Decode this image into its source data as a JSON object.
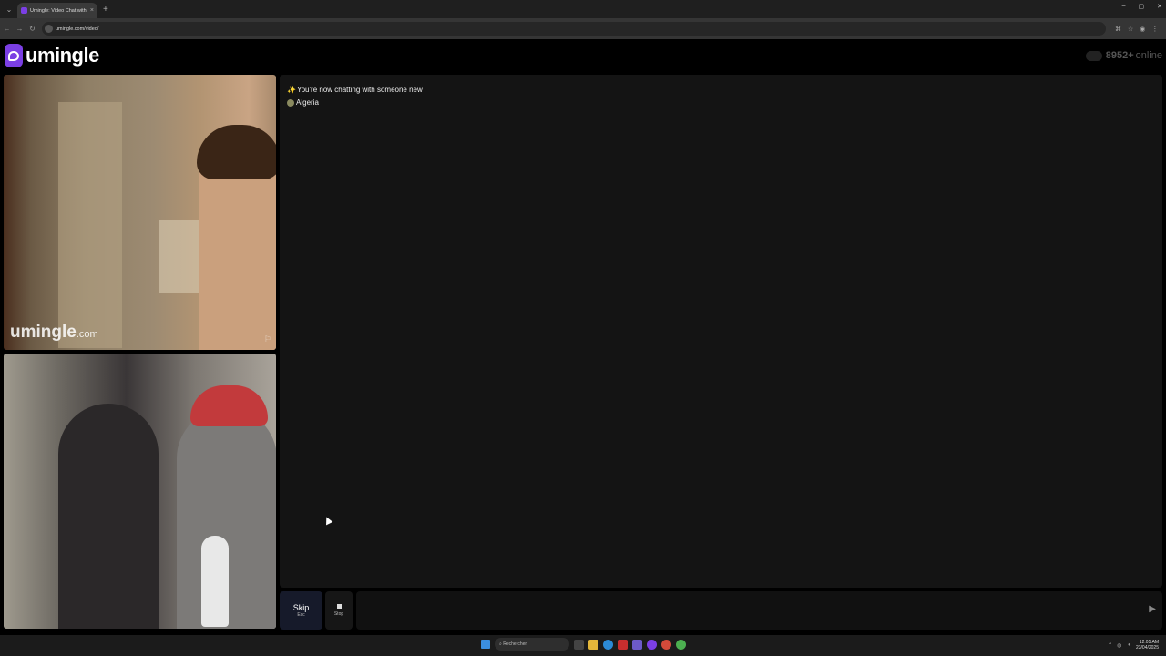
{
  "browser": {
    "tab_title": "Umingle: Video Chat with S...",
    "url": "umingle.com/video/",
    "new_tab_symbol": "+",
    "close_symbol": "×",
    "window_controls": [
      "–",
      "▢",
      "✕"
    ]
  },
  "header": {
    "logo_text": "umingle",
    "online_count": "8952+",
    "online_suffix": "online"
  },
  "video": {
    "watermark_main": "umingle",
    "watermark_domain": ".com"
  },
  "chat": {
    "messages": [
      {
        "icon": "sparkle-icon",
        "text": "You're now chatting with someone new"
      },
      {
        "icon": "globe-icon",
        "text": "Algeria"
      }
    ]
  },
  "controls": {
    "skip_label": "Skip",
    "skip_key": "Esc",
    "stop_label": "Stop",
    "message_placeholder": ""
  },
  "taskbar": {
    "search_placeholder": "Rechercher",
    "time": "12:05 AM",
    "date": "23/04/2025"
  },
  "colors": {
    "brand": "#7b3fe4",
    "chat_bg": "#141414",
    "skip_bg": "#161a2a"
  }
}
